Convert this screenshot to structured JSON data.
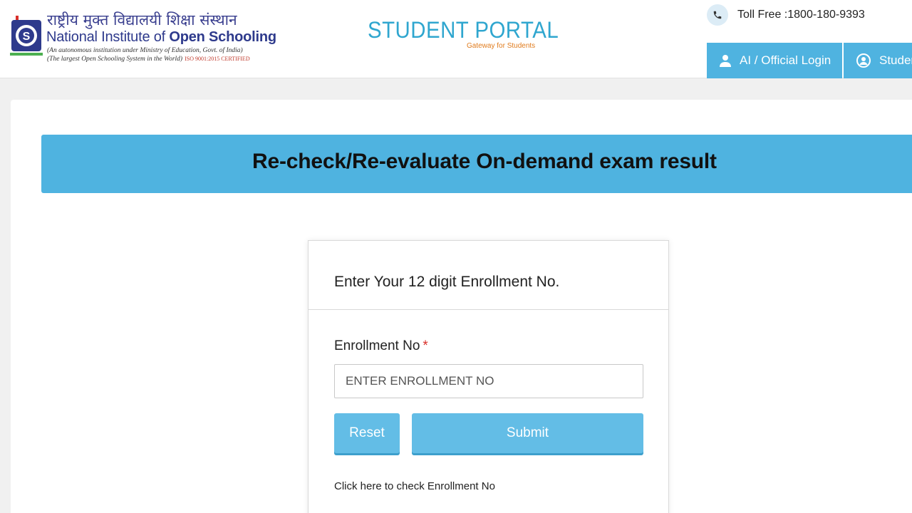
{
  "header": {
    "institute_hindi": "राष्ट्रीय मुक्त विद्यालयी शिक्षा संस्थान",
    "institute_name_prefix": "National Institute of ",
    "institute_name_bold": "Open Schooling",
    "institute_sub1": "(An autonomous institution under Ministry of Education, Govt. of India)",
    "institute_sub2": "(The largest Open Schooling System in the World)",
    "institute_iso": "ISO 9001:2015 CERTIFIED",
    "logo_icon": "nios-logo-icon",
    "portal_title": "STUDENT PORTAL",
    "portal_tagline": "Gateway for Students",
    "toll_free": "Toll Free :1800-180-9393",
    "nav": {
      "ai_login": "AI / Official Login",
      "student_login": "Student Login"
    }
  },
  "page": {
    "banner_title": "Re-check/Re-evaluate On-demand exam result"
  },
  "form": {
    "heading": "Enter Your 12 digit Enrollment No.",
    "enrollment_label": "Enrollment No",
    "required_mark": "*",
    "enrollment_placeholder": "ENTER ENROLLMENT NO",
    "enrollment_value": "",
    "reset_label": "Reset",
    "submit_label": "Submit",
    "check_link": "Click here to check Enrollment No"
  },
  "colors": {
    "accent": "#4fb3e0",
    "button": "#63bde6",
    "portal_title": "#2fa6cf",
    "tagline": "#e07b1c",
    "required": "#d9302a"
  }
}
